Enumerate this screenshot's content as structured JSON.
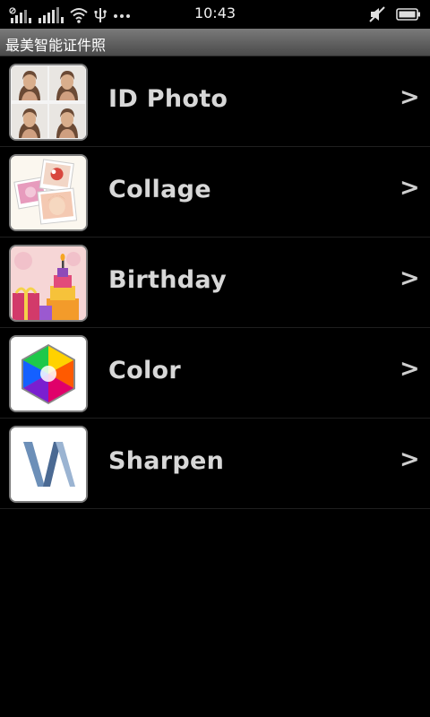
{
  "status_bar": {
    "time": "10:43",
    "icons": [
      "signal-1-icon",
      "signal-2-icon",
      "wifi-icon",
      "usb-icon",
      "more-icon",
      "mute-icon",
      "battery-icon"
    ]
  },
  "app": {
    "title": "最美智能证件照"
  },
  "menu": {
    "items": [
      {
        "label": "ID   Photo",
        "icon": "id-photo-thumbnail",
        "chevron": ">"
      },
      {
        "label": "Collage",
        "icon": "collage-thumbnail",
        "chevron": ">"
      },
      {
        "label": "Birthday",
        "icon": "birthday-thumbnail",
        "chevron": ">"
      },
      {
        "label": "Color",
        "icon": "color-thumbnail",
        "chevron": ">"
      },
      {
        "label": "Sharpen",
        "icon": "sharpen-thumbnail",
        "chevron": ">"
      }
    ]
  },
  "colors": {
    "background": "#000000",
    "title_bar": "#5a5a5a",
    "label_text": "#d8d8d8"
  }
}
